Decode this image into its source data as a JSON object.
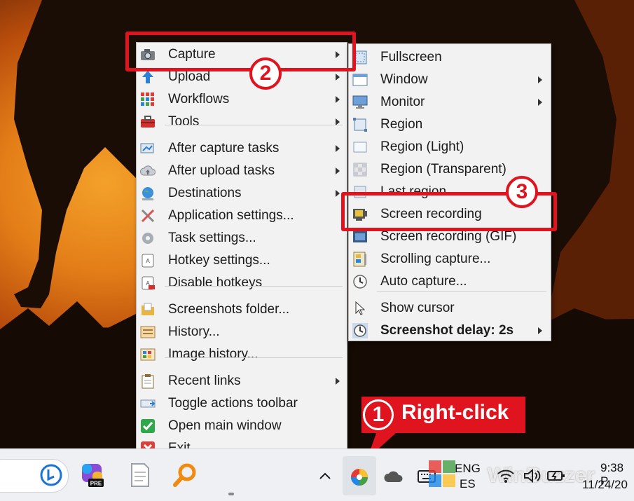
{
  "main_menu": {
    "items": [
      {
        "label": "Capture",
        "icon": "camera-icon",
        "submenu": true
      },
      {
        "label": "Upload",
        "icon": "upload-arrow-icon",
        "submenu": true
      },
      {
        "label": "Workflows",
        "icon": "workflows-grid-icon",
        "submenu": true
      },
      {
        "label": "Tools",
        "icon": "toolbox-icon",
        "submenu": true
      },
      {
        "label": "After capture tasks",
        "icon": "after-capture-icon",
        "submenu": true
      },
      {
        "label": "After upload tasks",
        "icon": "cloud-upload-icon",
        "submenu": true
      },
      {
        "label": "Destinations",
        "icon": "globe-icon",
        "submenu": true
      },
      {
        "label": "Application settings...",
        "icon": "wrench-screwdriver-icon",
        "submenu": false
      },
      {
        "label": "Task settings...",
        "icon": "gear-icon",
        "submenu": false
      },
      {
        "label": "Hotkey settings...",
        "icon": "key-icon",
        "submenu": false
      },
      {
        "label": "Disable hotkeys",
        "icon": "key-disabled-icon",
        "submenu": false
      },
      {
        "label": "Screenshots folder...",
        "icon": "folder-icon",
        "submenu": false
      },
      {
        "label": "History...",
        "icon": "history-icon",
        "submenu": false
      },
      {
        "label": "Image history...",
        "icon": "image-history-icon",
        "submenu": false
      },
      {
        "label": "Recent links",
        "icon": "clipboard-icon",
        "submenu": true
      },
      {
        "label": "Toggle actions toolbar",
        "icon": "toolbar-icon",
        "submenu": false
      },
      {
        "label": "Open main window",
        "icon": "check-icon",
        "submenu": false
      },
      {
        "label": "Exit",
        "icon": "exit-icon",
        "submenu": false
      }
    ]
  },
  "capture_menu": {
    "items": [
      {
        "label": "Fullscreen",
        "icon": "fullscreen-icon",
        "submenu": false
      },
      {
        "label": "Window",
        "icon": "window-icon",
        "submenu": true
      },
      {
        "label": "Monitor",
        "icon": "monitor-icon",
        "submenu": true
      },
      {
        "label": "Region",
        "icon": "region-icon",
        "submenu": false
      },
      {
        "label": "Region (Light)",
        "icon": "region-light-icon",
        "submenu": false
      },
      {
        "label": "Region (Transparent)",
        "icon": "region-transparent-icon",
        "submenu": false
      },
      {
        "label": "Last region",
        "icon": "last-region-icon",
        "submenu": false
      },
      {
        "label": "Screen recording",
        "icon": "screen-recording-icon",
        "submenu": false
      },
      {
        "label": "Screen recording (GIF)",
        "icon": "gif-recording-icon",
        "submenu": false
      },
      {
        "label": "Scrolling capture...",
        "icon": "scrolling-capture-icon",
        "submenu": false
      },
      {
        "label": "Auto capture...",
        "icon": "clock-icon",
        "submenu": false
      },
      {
        "label": "Show cursor",
        "icon": "cursor-icon",
        "submenu": false
      },
      {
        "label": "Screenshot delay: 2s",
        "icon": "delay-clock-icon",
        "submenu": true
      }
    ]
  },
  "callouts": {
    "step1": "1",
    "step1_text": "Right-click",
    "step2": "2",
    "step3": "3"
  },
  "taskbar": {
    "lang_line1": "ENG",
    "lang_line2": "ES",
    "time": "9:38 P",
    "date": "11/24/20",
    "watermark": "WinBuzzer"
  },
  "colors": {
    "callout_red": "#e0141e",
    "menu_bg": "#f2f2f2"
  }
}
